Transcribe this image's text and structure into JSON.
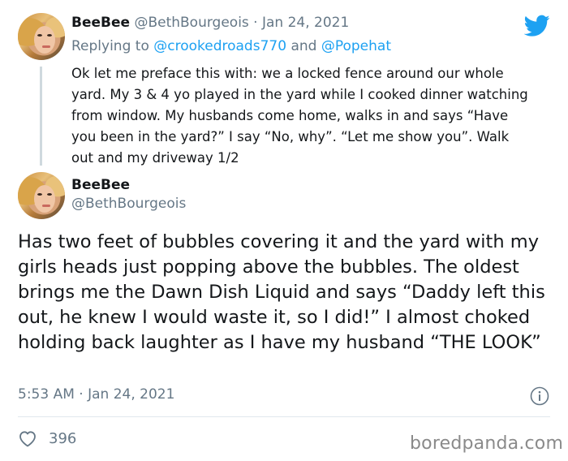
{
  "reply_tweet": {
    "display_name": "BeeBee",
    "handle": "@BethBourgeois",
    "separator": " · ",
    "date": "Jan 24, 2021",
    "replying_prefix": "Replying to ",
    "reply_to_1": "@crookedroads770",
    "reply_and": " and ",
    "reply_to_2": "@Popehat",
    "body": "Ok let me preface this with: we a locked fence around our whole yard. My 3 & 4 yo played in the yard while I cooked dinner watching from window. My husbands come home, walks in and says “Have you been in the yard?” I say “No, why”. “Let me show you”. Walk out and my driveway 1/2"
  },
  "main_tweet": {
    "display_name": "BeeBee",
    "handle": "@BethBourgeois",
    "body": "Has two feet of bubbles covering it and the yard with my girls heads just popping above the bubbles. The oldest brings me the Dawn Dish Liquid and says “Daddy left this out, he knew I would waste it, so I did!” I almost choked holding back laughter as I have my husband “THE LOOK”",
    "timestamp": "5:53 AM · Jan 24, 2021",
    "like_count": "396"
  },
  "watermark": "boredpanda.com",
  "colors": {
    "brand": "#1da1f2",
    "muted": "#657786",
    "text": "#14171a"
  },
  "icons": [
    "twitter-bird-icon",
    "info-icon",
    "heart-icon"
  ]
}
